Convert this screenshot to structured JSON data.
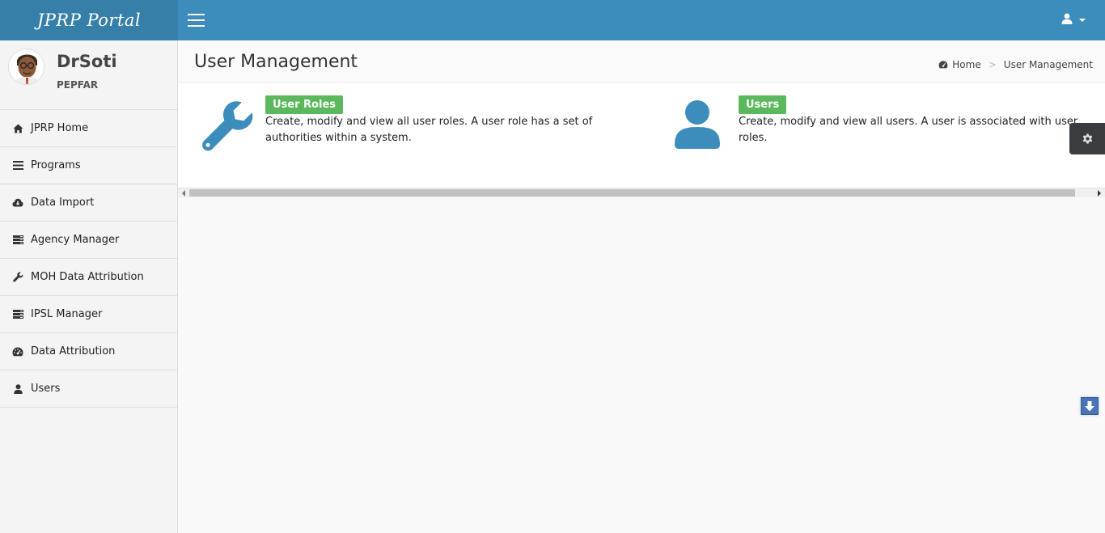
{
  "app": {
    "logo_text": "JPRP Portal"
  },
  "header": {
    "user_icon": "user-icon"
  },
  "sidebar": {
    "user": {
      "name": "DrSoti",
      "org": "PEPFAR"
    },
    "items": [
      {
        "label": "JPRP Home",
        "icon": "home-icon"
      },
      {
        "label": "Programs",
        "icon": "bars-icon"
      },
      {
        "label": "Data Import",
        "icon": "cloud-download-icon"
      },
      {
        "label": "Agency Manager",
        "icon": "server-icon"
      },
      {
        "label": "MOH Data Attribution",
        "icon": "wrench-icon"
      },
      {
        "label": "IPSL Manager",
        "icon": "server-icon"
      },
      {
        "label": "Data Attribution",
        "icon": "dashboard-icon"
      },
      {
        "label": "Users",
        "icon": "user-icon"
      }
    ]
  },
  "content": {
    "title": "User Management",
    "breadcrumb": {
      "home": "Home",
      "current": "User Management"
    },
    "cards": [
      {
        "label": "User Roles",
        "description": "Create, modify and view all user roles. A user role has a set of authorities within a system.",
        "icon": "wrench-icon"
      },
      {
        "label": "Users",
        "description": "Create, modify and view all users. A user is associated with user roles.",
        "icon": "user-icon"
      }
    ]
  },
  "colors": {
    "header": "#3c8dbc",
    "logo_bg": "#367fa9",
    "badge": "#5cb85c",
    "icon_blue": "#3c8dbc"
  }
}
